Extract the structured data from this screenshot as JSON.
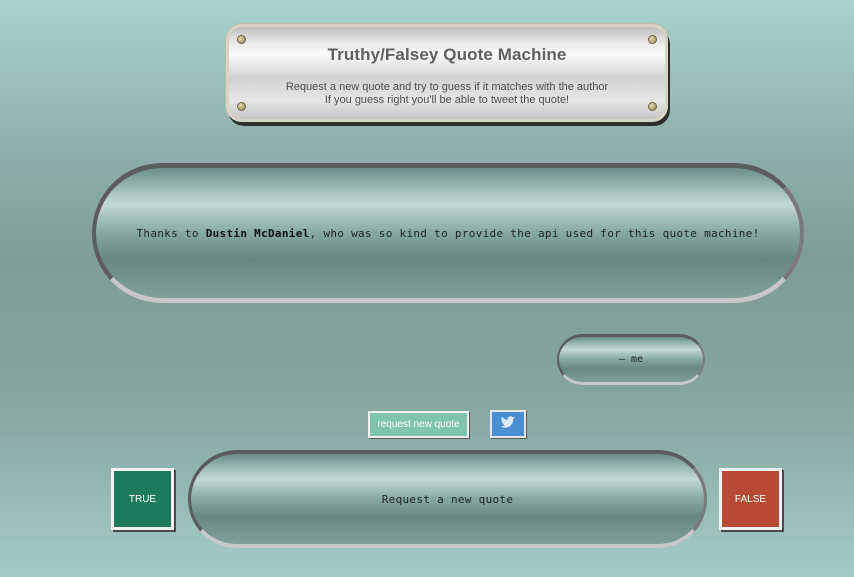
{
  "header": {
    "title": "Truthy/Falsey Quote Machine",
    "subtitle_line1": "Request a new quote and try to guess if it matches with the author",
    "subtitle_line2": "If you guess right you'll be able to tweet the quote!"
  },
  "quote": {
    "prefix": "Thanks to ",
    "name": "Dustin McDaniel",
    "suffix": ", who was so kind to provide the api used for this quote machine!"
  },
  "author": {
    "text": "— me"
  },
  "buttons": {
    "request_label": "request new quote",
    "tweet_icon": "twitter-bird-icon",
    "true_label": "TRUE",
    "false_label": "FALSE"
  },
  "answer": {
    "text": "Request a new quote"
  },
  "colors": {
    "true_button": "#1d7a5c",
    "false_button": "#b84a35",
    "request_button": "#7fc4ac",
    "tweet_button": "#4a8fd4"
  }
}
